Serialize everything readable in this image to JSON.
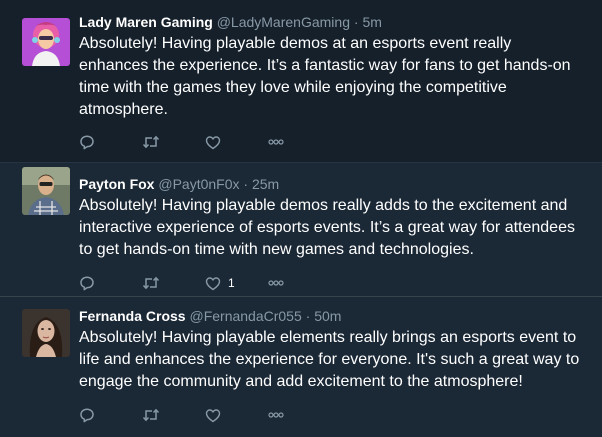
{
  "tweets": [
    {
      "name": "Lady Maren Gaming",
      "handle": "@LadyMarenGaming",
      "separator": "·",
      "time": "5m",
      "text": "Absolutely! Having playable demos at an esports event really enhances the experience. It’s a fantastic way for fans to get hands-on time with the games they love while enjoying the competitive atmosphere.",
      "like_count": "",
      "avatar": "cartoon-gamer-avatar"
    },
    {
      "name": "Payton Fox",
      "handle": "@Payt0nF0x",
      "separator": "·",
      "time": "25m",
      "text": "Absolutely! Having playable demos really adds to the excitement and interactive experience of esports events. It’s a great way for attendees to get hands-on time with new games and technologies.",
      "like_count": "1",
      "avatar": "photo-avatar-man"
    },
    {
      "name": "Fernanda Cross",
      "handle": "@FernandaCr055",
      "separator": "·",
      "time": "50m",
      "text": "Absolutely! Having playable elements really brings an esports event to life and enhances the experience for everyone. It's such a great way to engage the community and add excitement to the atmosphere!",
      "like_count": "",
      "avatar": "photo-avatar-woman"
    }
  ],
  "colors": {
    "background": "#1b2836",
    "highlight_background": "#15202b",
    "muted_text": "#8899a6",
    "divider": "#38444d"
  }
}
